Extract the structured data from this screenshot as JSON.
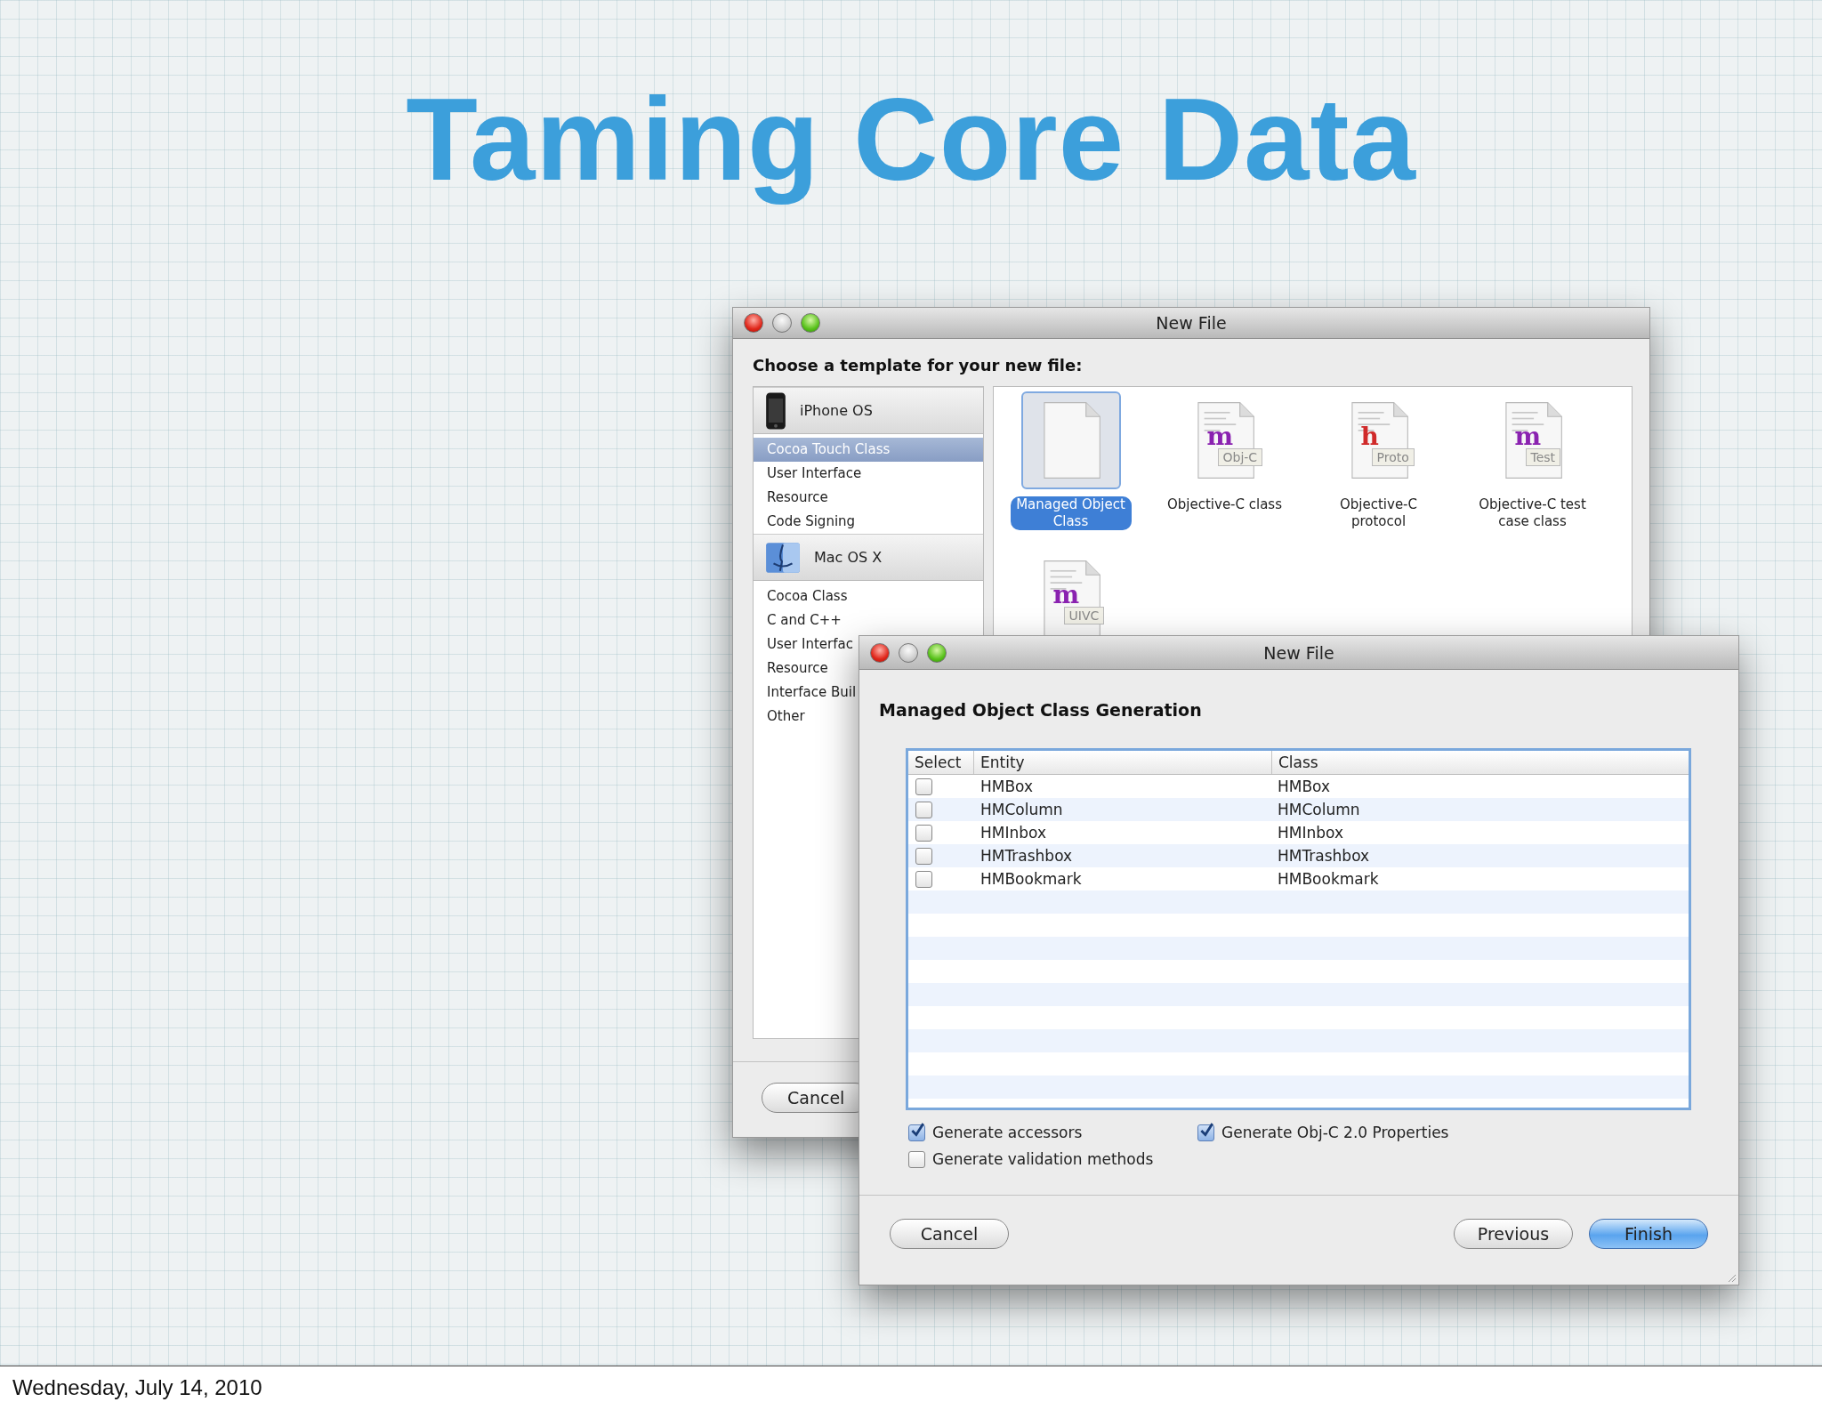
{
  "slide": {
    "title": "Taming Core Data",
    "footer_date": "Wednesday, July 14, 2010"
  },
  "template_window": {
    "title": "New File",
    "heading": "Choose a template for your new file:",
    "categories": [
      {
        "kind": "header",
        "label": "iPhone OS",
        "selected": false
      },
      {
        "kind": "item",
        "label": "Cocoa Touch Class",
        "selected": true
      },
      {
        "kind": "item",
        "label": "User Interface",
        "selected": false
      },
      {
        "kind": "item",
        "label": "Resource",
        "selected": false
      },
      {
        "kind": "item",
        "label": "Code Signing",
        "selected": false
      },
      {
        "kind": "header",
        "label": "Mac OS X",
        "selected": false
      },
      {
        "kind": "item",
        "label": "Cocoa Class",
        "selected": false
      },
      {
        "kind": "item",
        "label": "C and C++",
        "selected": false
      },
      {
        "kind": "item",
        "label": "User Interfac",
        "selected": false
      },
      {
        "kind": "item",
        "label": "Resource",
        "selected": false
      },
      {
        "kind": "item",
        "label": "Interface Buil",
        "selected": false
      },
      {
        "kind": "item",
        "label": "Other",
        "selected": false
      }
    ],
    "templates": [
      {
        "label": "Managed Object Class",
        "selected": true
      },
      {
        "label": "Objective-C class",
        "letter": "m",
        "color": "#8a22b0",
        "badge": "Obj-C",
        "selected": false
      },
      {
        "label": "Objective-C protocol",
        "letter": "h",
        "color": "#d02a2a",
        "badge": "Proto",
        "selected": false
      },
      {
        "label": "Objective-C test case class",
        "letter": "m",
        "color": "#8a22b0",
        "badge": "Test",
        "selected": false
      },
      {
        "letter": "m",
        "color": "#8a22b0",
        "badge": "UIVC",
        "selected": false
      }
    ],
    "buttons": [
      {
        "label": "Cancel"
      }
    ]
  },
  "generation_window": {
    "title": "New File",
    "heading": "Managed Object Class Generation",
    "columns": [
      "Select",
      "Entity",
      "Class"
    ],
    "rows": [
      {
        "entity": "HMBox",
        "class": "HMBox",
        "checked": false
      },
      {
        "entity": "HMColumn",
        "class": "HMColumn",
        "checked": false
      },
      {
        "entity": "HMInbox",
        "class": "HMInbox",
        "checked": false
      },
      {
        "entity": "HMTrashbox",
        "class": "HMTrashbox",
        "checked": false
      },
      {
        "entity": "HMBookmark",
        "class": "HMBookmark",
        "checked": false
      }
    ],
    "options": [
      {
        "label": "Generate accessors",
        "checked": true
      },
      {
        "label": "Generate Obj-C 2.0 Properties",
        "checked": true
      },
      {
        "label": "Generate validation methods",
        "checked": false
      }
    ],
    "buttons": [
      {
        "label": "Cancel",
        "default": false
      },
      {
        "label": "Previous",
        "default": false
      },
      {
        "label": "Finish",
        "default": true
      }
    ]
  }
}
